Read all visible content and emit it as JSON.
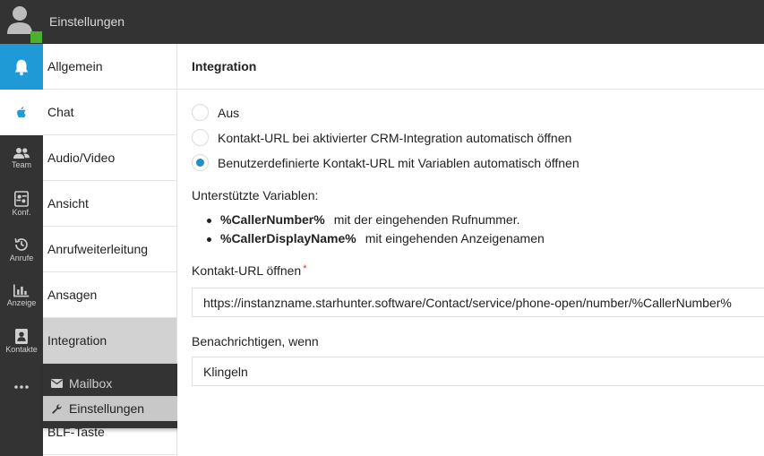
{
  "header": {
    "title": "Einstellungen"
  },
  "rail": [
    {
      "icon": "bell-icon",
      "label": ""
    },
    {
      "icon": "apple-icon",
      "label": ""
    },
    {
      "icon": "team-icon",
      "label": "Team"
    },
    {
      "icon": "conference-icon",
      "label": "Konf."
    },
    {
      "icon": "history-icon",
      "label": "Anrufe"
    },
    {
      "icon": "chart-icon",
      "label": "Anzeige"
    },
    {
      "icon": "contacts-icon",
      "label": "Kontakte"
    },
    {
      "icon": "more-icon",
      "label": ""
    }
  ],
  "menu": {
    "items": [
      "Allgemein",
      "Chat",
      "Audio/Video",
      "Ansicht",
      "Anrufweiterleitung",
      "Ansagen",
      "Integration",
      "BLF-Taste"
    ],
    "active": "Integration"
  },
  "popup": {
    "items": [
      {
        "icon": "envelope-icon",
        "label": "Mailbox"
      },
      {
        "icon": "wrench-icon",
        "label": "Einstellungen"
      }
    ]
  },
  "main": {
    "title": "Integration",
    "options": [
      "Aus",
      "Kontakt-URL bei aktivierter CRM-Integration automatisch öffnen",
      "Benutzerdefinierte Kontakt-URL mit Variablen automatisch öffnen"
    ],
    "selected_option": 2,
    "variables_label": "Unterstützte Variablen:",
    "variables": [
      {
        "name": "%CallerNumber%",
        "desc": "mit der eingehenden Rufnummer."
      },
      {
        "name": "%CallerDisplayName%",
        "desc": "mit eingehenden Anzeigenamen"
      }
    ],
    "url_label": "Kontakt-URL öffnen",
    "required_mark": "*",
    "url_value": "https://instanzname.starhunter.software/Contact/service/phone-open/number/%CallerNumber%",
    "notify_label": "Benachrichtigen, wenn",
    "notify_value": "Klingeln"
  },
  "colors": {
    "accent": "#1f9ad6",
    "rail": "#333333",
    "presence": "#4caf2d"
  }
}
